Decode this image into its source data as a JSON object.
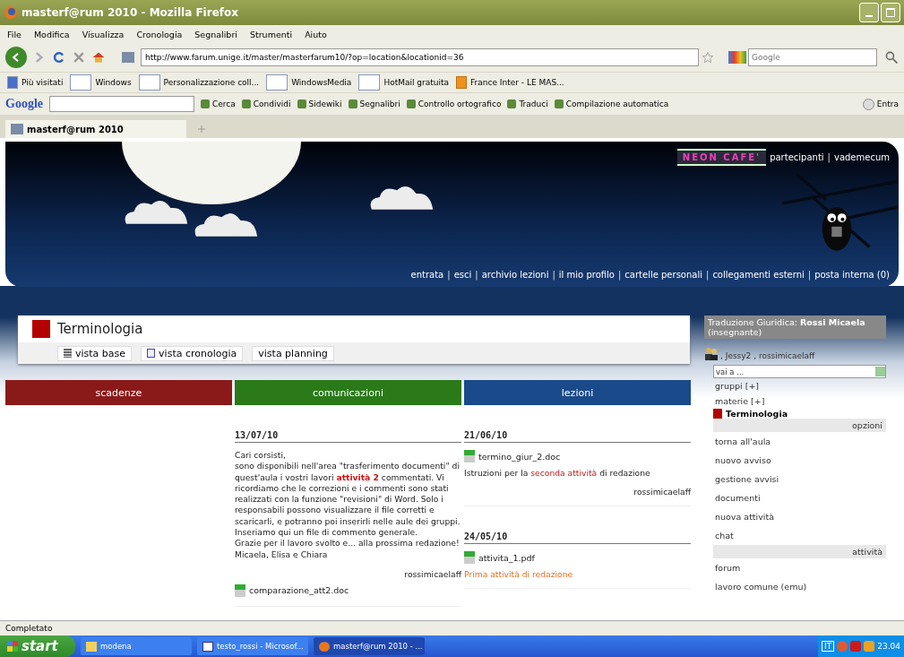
{
  "window": {
    "title": "masterf@rum 2010 - Mozilla Firefox"
  },
  "menu": [
    "File",
    "Modifica",
    "Visualizza",
    "Cronologia",
    "Segnalibri",
    "Strumenti",
    "Aiuto"
  ],
  "address": {
    "value": "http://www.farum.unige.it/master/masterfarum10/?op=location&locationid=36"
  },
  "search": {
    "placeholder": "Google"
  },
  "bookmarks": [
    {
      "label": "Più visitati",
      "kind": "special"
    },
    {
      "label": "Windows",
      "kind": "page"
    },
    {
      "label": "Personalizzazione coll...",
      "kind": "page"
    },
    {
      "label": "WindowsMedia",
      "kind": "page"
    },
    {
      "label": "HotMail gratuita",
      "kind": "page"
    },
    {
      "label": "France Inter - LE MAS...",
      "kind": "feed"
    }
  ],
  "google_toolbar": {
    "brand": "Google",
    "items": [
      "Cerca",
      "Condividi",
      "Sidewiki",
      "Segnalibri",
      "Controllo ortografico",
      "Traduci",
      "Compilazione automatica"
    ],
    "signin": "Entra"
  },
  "tabs": [
    {
      "label": "masterf@rum 2010",
      "selected": true
    }
  ],
  "header": {
    "logo": "NEON CAFE'",
    "separator": "|",
    "top_links": [
      "partecipanti",
      "vademecum"
    ],
    "nav": [
      "entrata",
      "esci",
      "archivio lezioni",
      "il mio profilo",
      "cartelle personali",
      "collegamenti esterni",
      "posta interna (0)"
    ]
  },
  "course": {
    "title": "Terminologia",
    "color": "#b30000",
    "views": [
      {
        "label": "vista base",
        "kind": "list"
      },
      {
        "label": "vista cronologia",
        "kind": "calendar"
      },
      {
        "label": "vista planning",
        "kind": "plain"
      }
    ]
  },
  "columns": [
    {
      "title": "scadenze",
      "color": "#8a1a1a"
    },
    {
      "title": "comunicazioni",
      "color": "#2a7a1a",
      "entries": [
        {
          "date": "13/07/10",
          "paragraphs": [
            "Cari corsisti,",
            "sono disponibili nell'area \"trasferimento documenti\" di quest'aula i vostri lavori **attività 2** commentati. Vi ricordiamo che le correzioni e i commenti sono stati realizzati con la funzione \"revisioni\" di Word. Solo i responsabili possono visualizzare il file corretti e scaricarli, e potranno poi inserirli nelle aule dei gruppi. Inseriamo qui un file di commento generale.",
            "Grazie per il lavoro svolto e... alla prossima redazione!",
            "Micaela, Elisa e Chiara"
          ],
          "author": "rossimicaelaff",
          "attachment": "comparazione_att2.doc"
        }
      ]
    },
    {
      "title": "lezioni",
      "color": "#1a4a8a",
      "entries": [
        {
          "date": "21/06/10",
          "attachment": "termino_giur_2.doc",
          "description": [
            {
              "text": "Istruzioni per la ",
              "highlight": false,
              "accent": false
            },
            {
              "text": "seconda attività",
              "highlight": true,
              "accent": false
            },
            {
              "text": " di redazione",
              "highlight": false,
              "accent": false
            }
          ],
          "author": "rossimicaelaff"
        },
        {
          "date": "24/05/10",
          "attachment": "attivita_1.pdf",
          "description": [
            {
              "text": "Prima attività di redazione",
              "highlight": false,
              "accent": true
            }
          ]
        }
      ]
    }
  ],
  "sidebar": {
    "info": "Traduzione Giuridica: **Rossi Micaela** (insegnante)",
    "users": ", Jessy2 , rossimicaelaff",
    "select": {
      "value": "vai a ..."
    },
    "links": [
      "gruppi [+]",
      "materie [+]"
    ],
    "current": "Terminologia",
    "sections": [
      {
        "title": "opzioni",
        "items": [
          "torna all'aula",
          "nuovo avviso",
          "gestione avvisi",
          "documenti",
          "nuova attività",
          "chat"
        ]
      },
      {
        "title": "attività",
        "items": [
          "forum",
          "lavoro comune (emu)"
        ]
      }
    ]
  },
  "status_bar": "Completato",
  "taskbar": {
    "start": "start",
    "tasks": [
      {
        "label": "modena",
        "kind": "folder",
        "selected": false
      },
      {
        "label": "testo_rossi - Microsof...",
        "kind": "document",
        "selected": false
      },
      {
        "label": "masterf@rum 2010 - ...",
        "kind": "browser",
        "selected": true
      }
    ],
    "language": "IT",
    "clock": "23.04"
  }
}
